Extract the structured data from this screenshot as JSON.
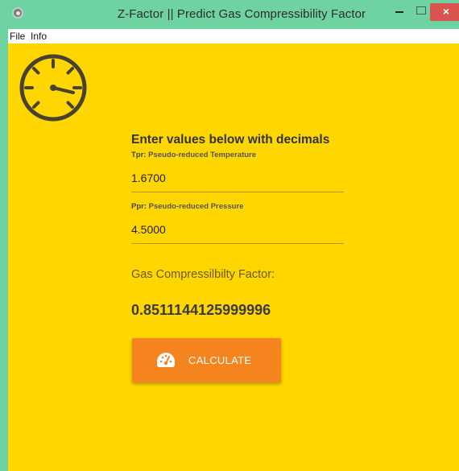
{
  "window": {
    "title": "Z-Factor || Predict Gas Compressibility Factor",
    "minimize_label": "–",
    "close_label": "×"
  },
  "menu": {
    "items": [
      "File",
      "Info"
    ]
  },
  "form": {
    "heading": "Enter values below with decimals",
    "tpr": {
      "abbr": "Tpr:",
      "label": "Pseudo-reduced Temperature",
      "value": "1.6700"
    },
    "ppr": {
      "abbr": "Ppr:",
      "label": "Pseudo-reduced Pressure",
      "value": "4.5000"
    }
  },
  "result": {
    "label": "Gas Compressilbilty Factor:",
    "value": "0.8511144125999996"
  },
  "button": {
    "label": "CALCULATE"
  },
  "colors": {
    "background": "#ffd600",
    "accent": "#f5841f",
    "titlebar": "#6fd3a1",
    "close": "#d9534f"
  },
  "icons": {
    "app": "app-icon",
    "gauge": "gauge-icon",
    "button": "speedometer-icon"
  }
}
